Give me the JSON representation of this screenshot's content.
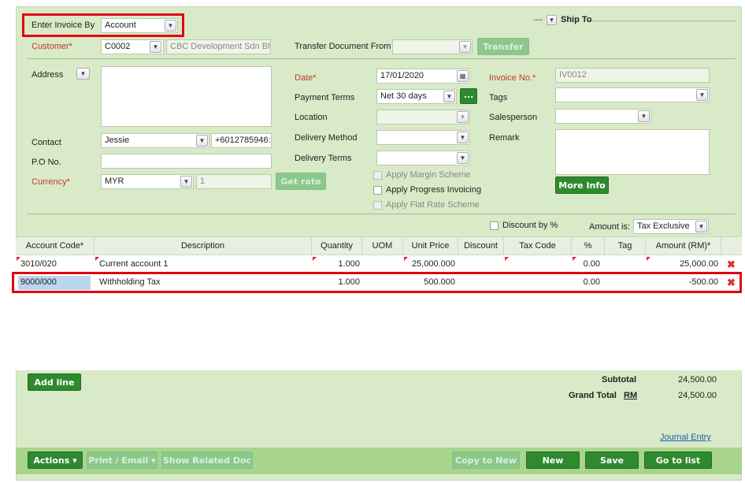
{
  "header": {
    "enter_by_label": "Enter Invoice By",
    "enter_by_value": "Account",
    "ship_to_label": "Ship To",
    "ship_toggle": "—"
  },
  "customer": {
    "label": "Customer*",
    "code": "C0002",
    "name": "CBC Development Sdn Bhc"
  },
  "transfer": {
    "label": "Transfer Document From",
    "value": "",
    "button": "Transfer"
  },
  "address": {
    "label": "Address",
    "value": ""
  },
  "contact": {
    "label": "Contact",
    "name": "Jessie",
    "phone": "+6012785946:"
  },
  "po": {
    "label": "P.O No.",
    "value": ""
  },
  "currency": {
    "label": "Currency*",
    "value": "MYR",
    "rate": "1",
    "get_rate": "Get rate"
  },
  "middle": {
    "date_label": "Date*",
    "date_value": "17/01/2020",
    "payment_terms_label": "Payment Terms",
    "payment_terms_value": "Net 30 days",
    "payment_terms_more": "...",
    "location_label": "Location",
    "location_value": "",
    "delivery_method_label": "Delivery Method",
    "delivery_method_value": "",
    "delivery_terms_label": "Delivery Terms",
    "delivery_terms_value": "",
    "apply_margin": "Apply Margin Scheme",
    "apply_progress": "Apply Progress Invoicing",
    "apply_flat": "Apply Flat Rate Scheme"
  },
  "right": {
    "invoice_no_label": "Invoice No.*",
    "invoice_no_value": "IV0012",
    "tags_label": "Tags",
    "tags_value": "",
    "salesperson_label": "Salesperson",
    "salesperson_value": "",
    "remark_label": "Remark",
    "remark_value": "",
    "more_info": "More Info"
  },
  "options": {
    "discount_by_pct": "Discount by %",
    "amount_is_label": "Amount is:",
    "amount_is_value": "Tax Exclusive"
  },
  "grid": {
    "headers": [
      "Account Code*",
      "Description",
      "Quantity",
      "UOM",
      "Unit Price",
      "Discount",
      "Tax Code",
      "%",
      "Tag",
      "Amount (RM)*"
    ],
    "rows": [
      {
        "account": "3010/020",
        "description": "Current account 1",
        "quantity": "1.000",
        "uom": "",
        "unit_price": "25,000.000",
        "discount": "",
        "tax_code": "",
        "pct": "0.00",
        "tag": "",
        "amount": "25,000.00"
      },
      {
        "account": "9000/000",
        "description": "Withholding Tax",
        "quantity": "1.000",
        "uom": "",
        "unit_price": "500.000",
        "discount": "",
        "tax_code": "",
        "pct": "0.00",
        "tag": "",
        "amount": "-500.00"
      }
    ],
    "delete_symbol": "✖"
  },
  "totals": {
    "add_line": "Add line",
    "subtotal_label": "Subtotal",
    "subtotal_value": "24,500.00",
    "grand_total_label": "Grand Total",
    "grand_total_currency": "RM",
    "grand_total_value": "24,500.00",
    "journal_entry": "Journal Entry"
  },
  "footer": {
    "actions": "Actions",
    "print_email": "Print / Email",
    "show_related": "Show Related Doc",
    "copy_to_new": "Copy to New",
    "new": "New",
    "save": "Save",
    "go_to_list": "Go to list"
  },
  "colors": {
    "panel_bg": "#d9eac8",
    "button_green": "#2f8a2f",
    "button_disabled": "#8cc88c",
    "required_red": "#c0392b",
    "highlight_red": "#e3060f",
    "selected_cell": "#bcd6ee"
  }
}
